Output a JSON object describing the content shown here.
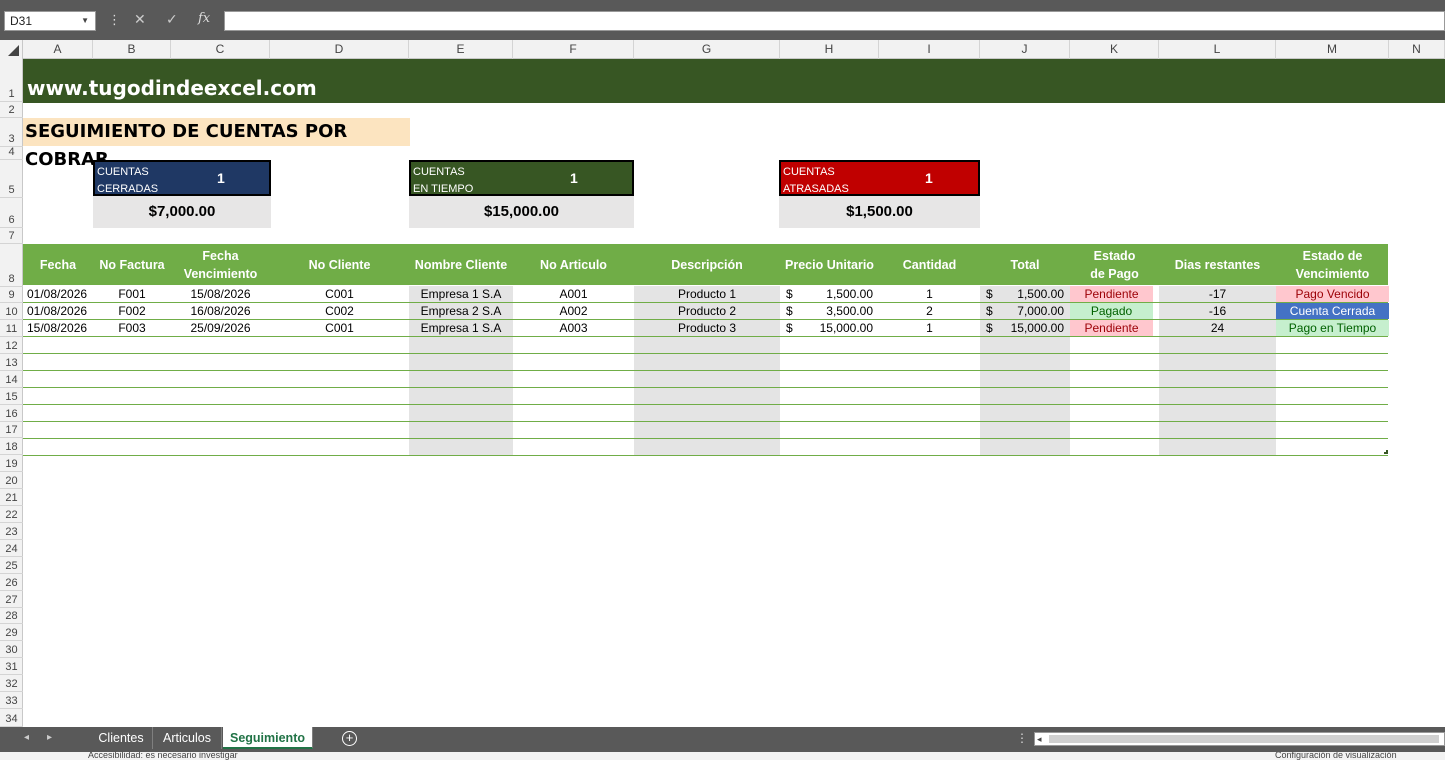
{
  "formula_bar": {
    "name_box": "D31",
    "fx_icon": "fx"
  },
  "columns": [
    "A",
    "B",
    "C",
    "D",
    "E",
    "F",
    "G",
    "H",
    "I",
    "J",
    "K",
    "L",
    "M",
    "N"
  ],
  "rows": [
    "1",
    "2",
    "3",
    "4",
    "5",
    "6",
    "7",
    "8",
    "9",
    "10",
    "11",
    "12",
    "13",
    "14",
    "15",
    "16",
    "17",
    "18",
    "19",
    "20",
    "21",
    "22",
    "23",
    "24",
    "25",
    "26",
    "27",
    "28",
    "29",
    "30",
    "31",
    "32",
    "33",
    "34"
  ],
  "sheet": {
    "website": "www.tugodindeexcel.com",
    "title": "SEGUIMIENTO DE CUENTAS POR COBRAR",
    "kpis": [
      {
        "label": "CUENTAS CERRADAS",
        "count": "1",
        "amount": "$7,000.00",
        "color": "#1f3864"
      },
      {
        "label": "CUENTAS EN TIEMPO",
        "count": "1",
        "amount": "$15,000.00",
        "color": "#375623"
      },
      {
        "label": "CUENTAS ATRASADAS",
        "count": "1",
        "amount": "$1,500.00",
        "color": "#c00000"
      }
    ],
    "table": {
      "headers": [
        "Fecha",
        "No Factura",
        "Fecha Vencimiento",
        "No Cliente",
        "Nombre Cliente",
        "No Articulo",
        "Descripción",
        "Precio Unitario",
        "Cantidad",
        "Total",
        "Estado de Pago",
        "Dias restantes",
        "Estado de Vencimiento"
      ],
      "rows": [
        {
          "fecha": "01/08/2026",
          "factura": "F001",
          "vencimiento": "15/08/2026",
          "cliente": "C001",
          "nombre": "Empresa 1 S.A",
          "articulo": "A001",
          "descripcion": "Producto 1",
          "precio": "1,500.00",
          "cantidad": "1",
          "total": "1,500.00",
          "estado_pago": "Pendiente",
          "dias": "-17",
          "estado_venc": "Pago Vencido"
        },
        {
          "fecha": "01/08/2026",
          "factura": "F002",
          "vencimiento": "16/08/2026",
          "cliente": "C002",
          "nombre": "Empresa 2 S.A",
          "articulo": "A002",
          "descripcion": "Producto 2",
          "precio": "3,500.00",
          "cantidad": "2",
          "total": "7,000.00",
          "estado_pago": "Pagado",
          "dias": "-16",
          "estado_venc": "Cuenta Cerrada"
        },
        {
          "fecha": "15/08/2026",
          "factura": "F003",
          "vencimiento": "25/09/2026",
          "cliente": "C001",
          "nombre": "Empresa 1 S.A",
          "articulo": "A003",
          "descripcion": "Producto 3",
          "precio": "15,000.00",
          "cantidad": "1",
          "total": "15,000.00",
          "estado_pago": "Pendiente",
          "dias": "24",
          "estado_venc": "Pago en Tiempo"
        }
      ],
      "currency_symbol": "$"
    }
  },
  "tabs": [
    {
      "label": "Clientes",
      "active": false
    },
    {
      "label": "Articulos",
      "active": false
    },
    {
      "label": "Seguimiento",
      "active": true
    }
  ],
  "status": {
    "accessibility": "Accesibilidad: es necesario investigar",
    "display": "Configuración de visualización"
  }
}
